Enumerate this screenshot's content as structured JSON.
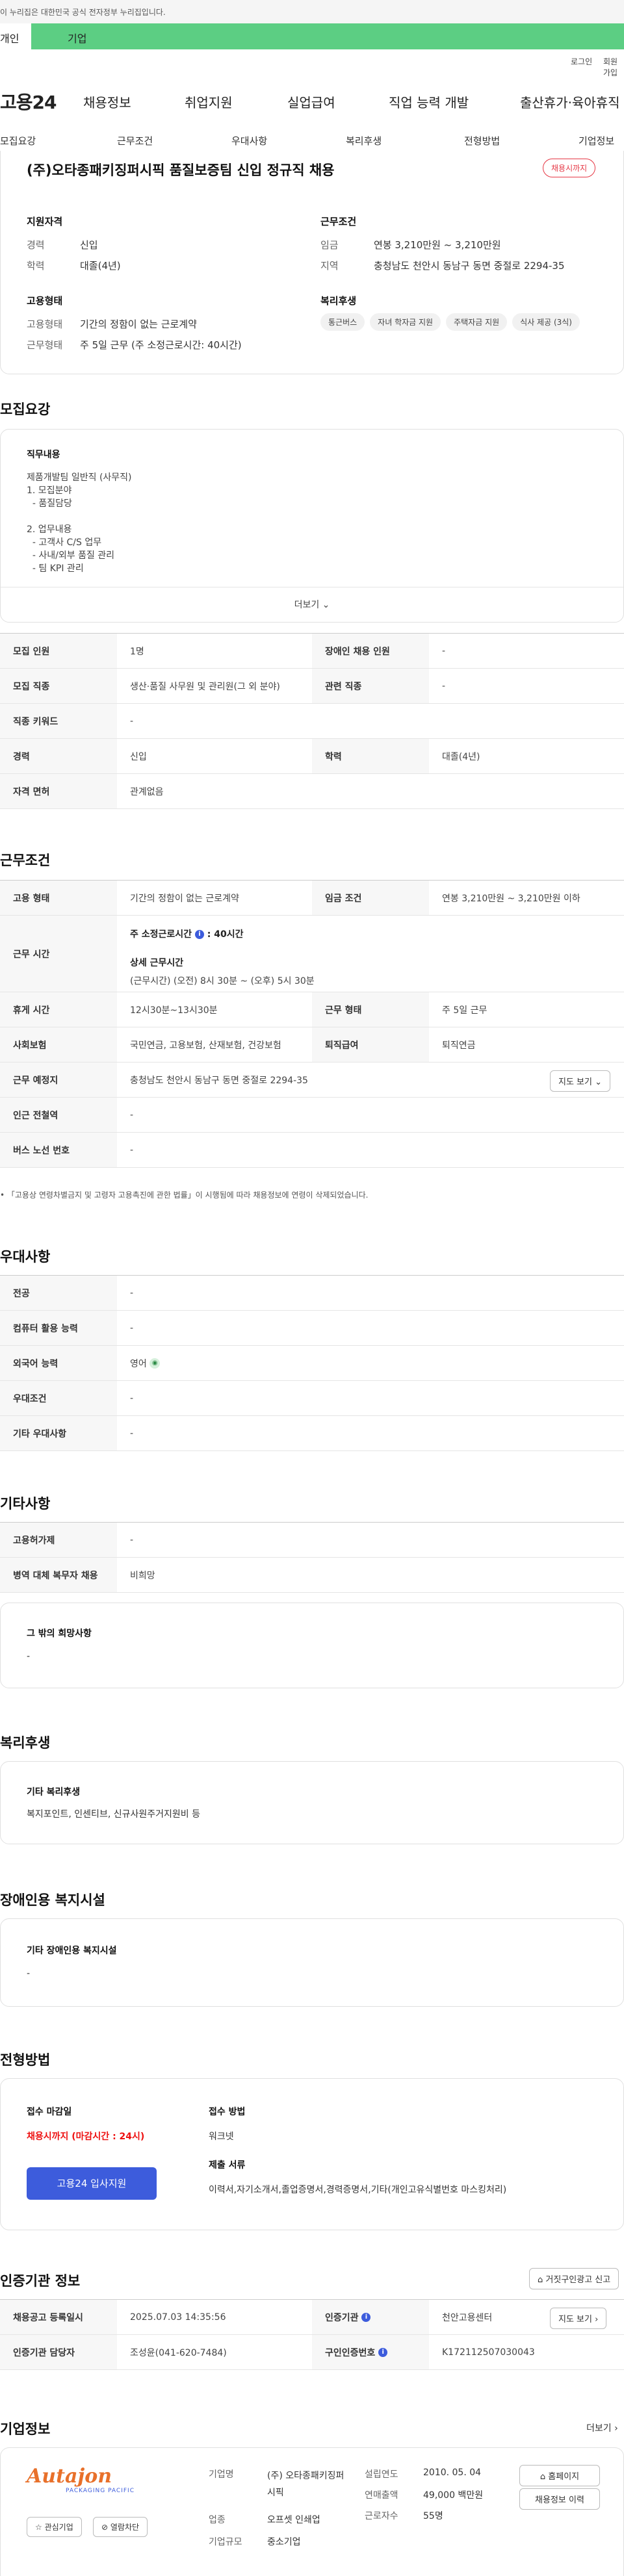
{
  "gov_banner": "이 누리집은 대한민국 공식 전자정부 누리집입니다.",
  "user_tabs": [
    "개인",
    "기업"
  ],
  "util": {
    "login": "로그인",
    "join": "회원가입"
  },
  "logo": "고용24",
  "gnb": [
    "채용정보",
    "취업지원",
    "실업급여",
    "직업 능력 개발",
    "출산휴가·육아휴직"
  ],
  "anchors": [
    "모집요강",
    "근무조건",
    "우대사항",
    "복리후생",
    "전형방법",
    "기업정보"
  ],
  "summary": {
    "title": "(주)오타종패키징퍼시픽 품질보증팀 신입 정규직 채용",
    "badge": "채용시까지",
    "qual_h": "지원자격",
    "exp_l": "경력",
    "exp_v": "신입",
    "edu_l": "학력",
    "edu_v": "대졸(4년)",
    "cond_h": "근무조건",
    "wage_l": "임금",
    "wage_v": "연봉 3,210만원 ~ 3,210만원",
    "area_l": "지역",
    "area_v": "충청남도 천안시 동남구 동면 중절로 2294-35",
    "emp_h": "고용형태",
    "emptype_l": "고용형태",
    "emptype_v": "기간의 정함이 없는 근로계약",
    "worktype_l": "근무형태",
    "worktype_v": "주 5일 근무 (주 소정근로시간: 40시간)",
    "ben_h": "복리후생",
    "chips": [
      "통근버스",
      "자녀 학자금 지원",
      "주택자금 지원",
      "식사 제공 (3식)"
    ]
  },
  "recruit": {
    "title": "모집요강",
    "duty_h": "직무내용",
    "duty_text": "제품개발팀 일반직 (사무직)\n1. 모집분야\n  - 품질담당\n\n2. 업무내용\n  - 고객사 C/S 업무\n  - 사내/외부 품질 관리\n  - 팀 KPI 관리",
    "more": "더보기",
    "rows": [
      {
        "a_l": "모집 인원",
        "a_v": "1명",
        "b_l": "장애인 채용 인원",
        "b_v": "-"
      },
      {
        "a_l": "모집 직종",
        "a_v": "생산·품질 사무원 및 관리원(그 외 분야)",
        "b_l": "관련 직종",
        "b_v": "-"
      }
    ],
    "kw_l": "직종 키워드",
    "kw_v": "-",
    "row3": {
      "a_l": "경력",
      "a_v": "신입",
      "b_l": "학력",
      "b_v": "대졸(4년)"
    },
    "lic_l": "자격 면허",
    "lic_v": "관계없음"
  },
  "cond": {
    "title": "근무조건",
    "r1": {
      "a_l": "고용 형태",
      "a_v": "기간의 정함이 없는 근로계약",
      "b_l": "임금 조건",
      "b_v": "연봉 3,210만원 ~ 3,210만원 이하"
    },
    "hours_l": "근무 시간",
    "hours_main": "주 소정근로시간",
    "hours_val": "40시간",
    "hours_sub": "상세 근무시간",
    "hours_detail": "(근무시간) (오전) 8시 30분 ~ (오후) 5시 30분",
    "r3": {
      "a_l": "휴게 시간",
      "a_v": "12시30분~13시30분",
      "b_l": "근무 형태",
      "b_v": "주 5일 근무"
    },
    "r4": {
      "a_l": "사회보험",
      "a_v": "국민연금, 고용보험, 산재보험, 건강보험",
      "b_l": "퇴직급여",
      "b_v": "퇴직연금"
    },
    "place_l": "근무 예정지",
    "place_v": "충청남도 천안시 동남구 동면 중절로 2294-35",
    "map_btn": "지도 보기",
    "sub_l": "인근 전철역",
    "sub_v": "-",
    "bus_l": "버스 노선 번호",
    "bus_v": "-",
    "note": "• 「고용상 연령차별금지 및 고령자 고용촉진에 관한 법률」이 시행됨에 따라 채용정보에 연령이 삭제되었습니다."
  },
  "pref": {
    "title": "우대사항",
    "rows": [
      {
        "l": "전공",
        "v": "-"
      },
      {
        "l": "컴퓨터 활용 능력",
        "v": "-"
      },
      {
        "l": "외국어 능력",
        "v": "영어"
      },
      {
        "l": "우대조건",
        "v": "-"
      },
      {
        "l": "기타 우대사항",
        "v": "-"
      }
    ]
  },
  "etc": {
    "title": "기타사항",
    "rows": [
      {
        "l": "고용허가제",
        "v": "-"
      },
      {
        "l": "병역 대체 복무자 채용",
        "v": "비희망"
      }
    ],
    "card_h": "그 밖의 희망사항",
    "card_v": "-"
  },
  "welfare": {
    "title": "복리후생",
    "card_h": "기타 복리후생",
    "card_v": "복지포인트, 인센티브, 신규사원주거지원비 등"
  },
  "disab": {
    "title": "장애인용 복지시설",
    "card_h": "기타 장애인용 복지시설",
    "card_v": "-"
  },
  "proc": {
    "title": "전형방법",
    "deadline_h": "접수 마감일",
    "deadline_v": "채용시까지 (마감시간 : 24시)",
    "apply_btn": "고용24 입사지원",
    "method_h": "접수 방법",
    "method_v": "워크넷",
    "docs_h": "제출 서류",
    "docs_v": "이력서,자기소개서,졸업증명서,경력증명서,기타(개인고유식별번호 마스킹처리)"
  },
  "cert": {
    "title": "인증기관 정보",
    "report_btn": "거짓구인광고 신고",
    "r1": {
      "a_l": "채용공고 등록일시",
      "a_v": "2025.07.03 14:35:56",
      "b_l": "인증기관",
      "b_v": "천안고용센터",
      "btn": "지도 보기"
    },
    "r2": {
      "a_l": "인증기관 담당자",
      "a_v": "조성윤(041-620-7484)",
      "b_l": "구인인증번호",
      "b_v": "K172112507030043"
    }
  },
  "company": {
    "title": "기업정보",
    "more": "더보기",
    "logo_text": "Autajon",
    "logo_sub": "PACKAGING PACIFIC",
    "fav_btn": "관심기업",
    "block_btn": "열람차단",
    "name_l": "기업명",
    "name_v": "(주) 오타종패키징퍼시픽",
    "ind_l": "업종",
    "ind_v": "오프셋 인쇄업",
    "size_l": "기업규모",
    "size_v": "중소기업",
    "year_l": "설립연도",
    "year_v": "2010. 05. 04",
    "sales_l": "연매출액",
    "sales_v": "49,000 백만원",
    "emp_l": "근로자수",
    "emp_v": "55명",
    "home_btn": "홈페이지",
    "hist_btn": "채용정보 이력"
  }
}
